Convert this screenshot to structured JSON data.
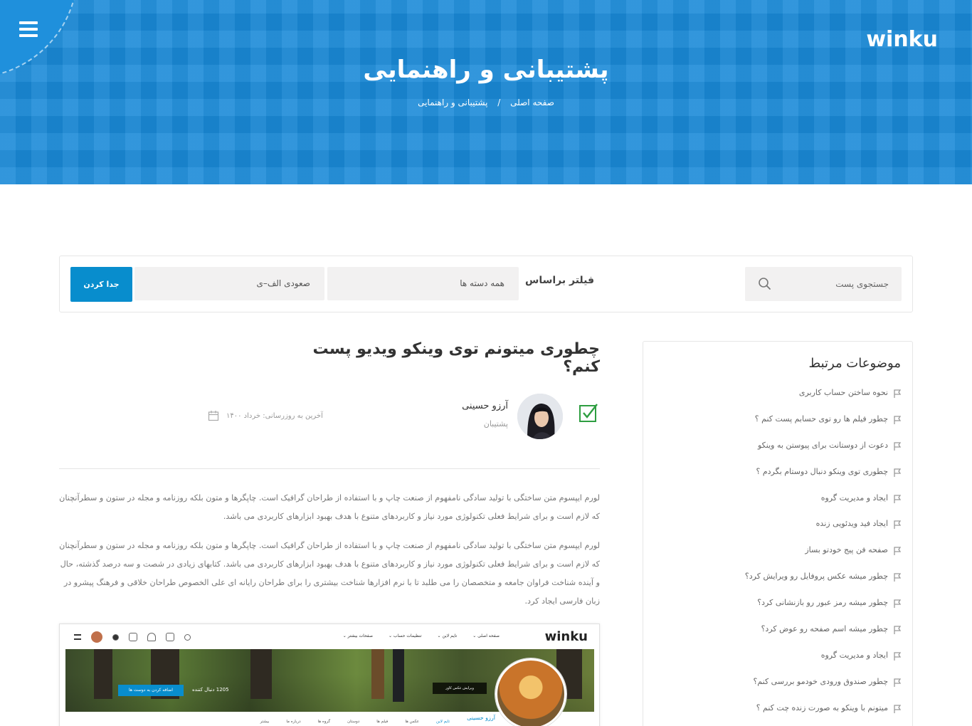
{
  "hero": {
    "logo": "winku",
    "title": "پشتیبانی و راهنمایی",
    "breadcrumb": {
      "home": "صفحه اصلی",
      "separator": "/",
      "current": "پشتیبانی و راهنمایی"
    }
  },
  "filter": {
    "search_placeholder": "جستجوی پست",
    "filter_label": "فیلتر براساس",
    "category_value": "همه دسته ها",
    "sort_value": "صعودی الف–ی",
    "separate_button": "جدا کردن"
  },
  "sidebar": {
    "title": "موضوعات مرتبط",
    "topics": [
      "نحوه ساختن حساب کاربری",
      "چطور فیلم ها رو توی حسابم پست کنم ؟",
      "دعوت از دوستانت برای پیوستن به وینکو",
      "چطوری توی وینکو دنبال دوستام بگردم ؟",
      "ایجاد و مدیریت گروه",
      "ایجاد فید ویدئویی زنده",
      "صفحه فن پیج خودتو بساز",
      "چطور میشه عکس پروفایل رو ویرایش کرد؟",
      "چطور میشه رمز عبور رو بازنشانی کرد؟",
      "چطور میشه اسم صفحه رو عوض کرد؟",
      "ایجاد و مدیریت گروه",
      "چطور صندوق ورودی خودمو بررسی کنم؟",
      "میتونم با وینکو به صورت زنده چت کنم ؟"
    ]
  },
  "post": {
    "title": "چطوری میتونم توی وینکو ویدیو پست کنم؟",
    "author_name": "آرزو حسینی",
    "author_role": "پشتیبان",
    "updated": "آخرین به روزرسانی: خرداد ۱۴۰۰",
    "paragraph1": "لورم ایپسوم متن ساختگی با تولید سادگی نامفهوم از صنعت چاپ و با استفاده از طراحان گرافیک است. چاپگرها و متون بلکه روزنامه و مجله در ستون و سطرآنچنان که لازم است و برای شرایط فعلی تکنولوژی مورد نیاز و کاربردهای متنوع با هدف بهبود ابزارهای کاربردی می باشد.",
    "paragraph2": "لورم ایپسوم متن ساختگی با تولید سادگی نامفهوم از صنعت چاپ و با استفاده از طراحان گرافیک است. چاپگرها و متون بلکه روزنامه و مجله در ستون و سطرآنچنان که لازم است و برای شرایط فعلی تکنولوژی مورد نیاز و کاربردهای متنوع با هدف بهبود ابزارهای کاربردی می باشد. کتابهای زیادی در شصت و سه درصد گذشته، حال و آینده شناخت فراوان جامعه و متخصصان را می طلبد تا با نرم افزارها شناخت بیشتری را برای طراحان رایانه ای علی الخصوص طراحان خلاقی و فرهنگ پیشرو در زبان فارسی ایجاد کرد."
  },
  "preview": {
    "logo": "winku",
    "menu": [
      "صفحه اصلی ⌄",
      "تایم لاین ⌄",
      "تنظیمات حساب ⌄",
      "صفحات بیشتر ⌄"
    ],
    "friends_button": "اضافه کردن به دوست ها",
    "followers": "1205 دنبال کننده",
    "edit_cover": "ویرایش عکس کاور",
    "name": "آرزو حسینی",
    "tabs": [
      "تایم لاین",
      "عکس ها",
      "فیلم ها",
      "دوستان",
      "گروه ها",
      "درباره ما",
      "بیشتر"
    ]
  },
  "colors": {
    "accent": "#088dcd",
    "hero_bg": "#1a8ad8",
    "check_green": "#2e9e41"
  }
}
